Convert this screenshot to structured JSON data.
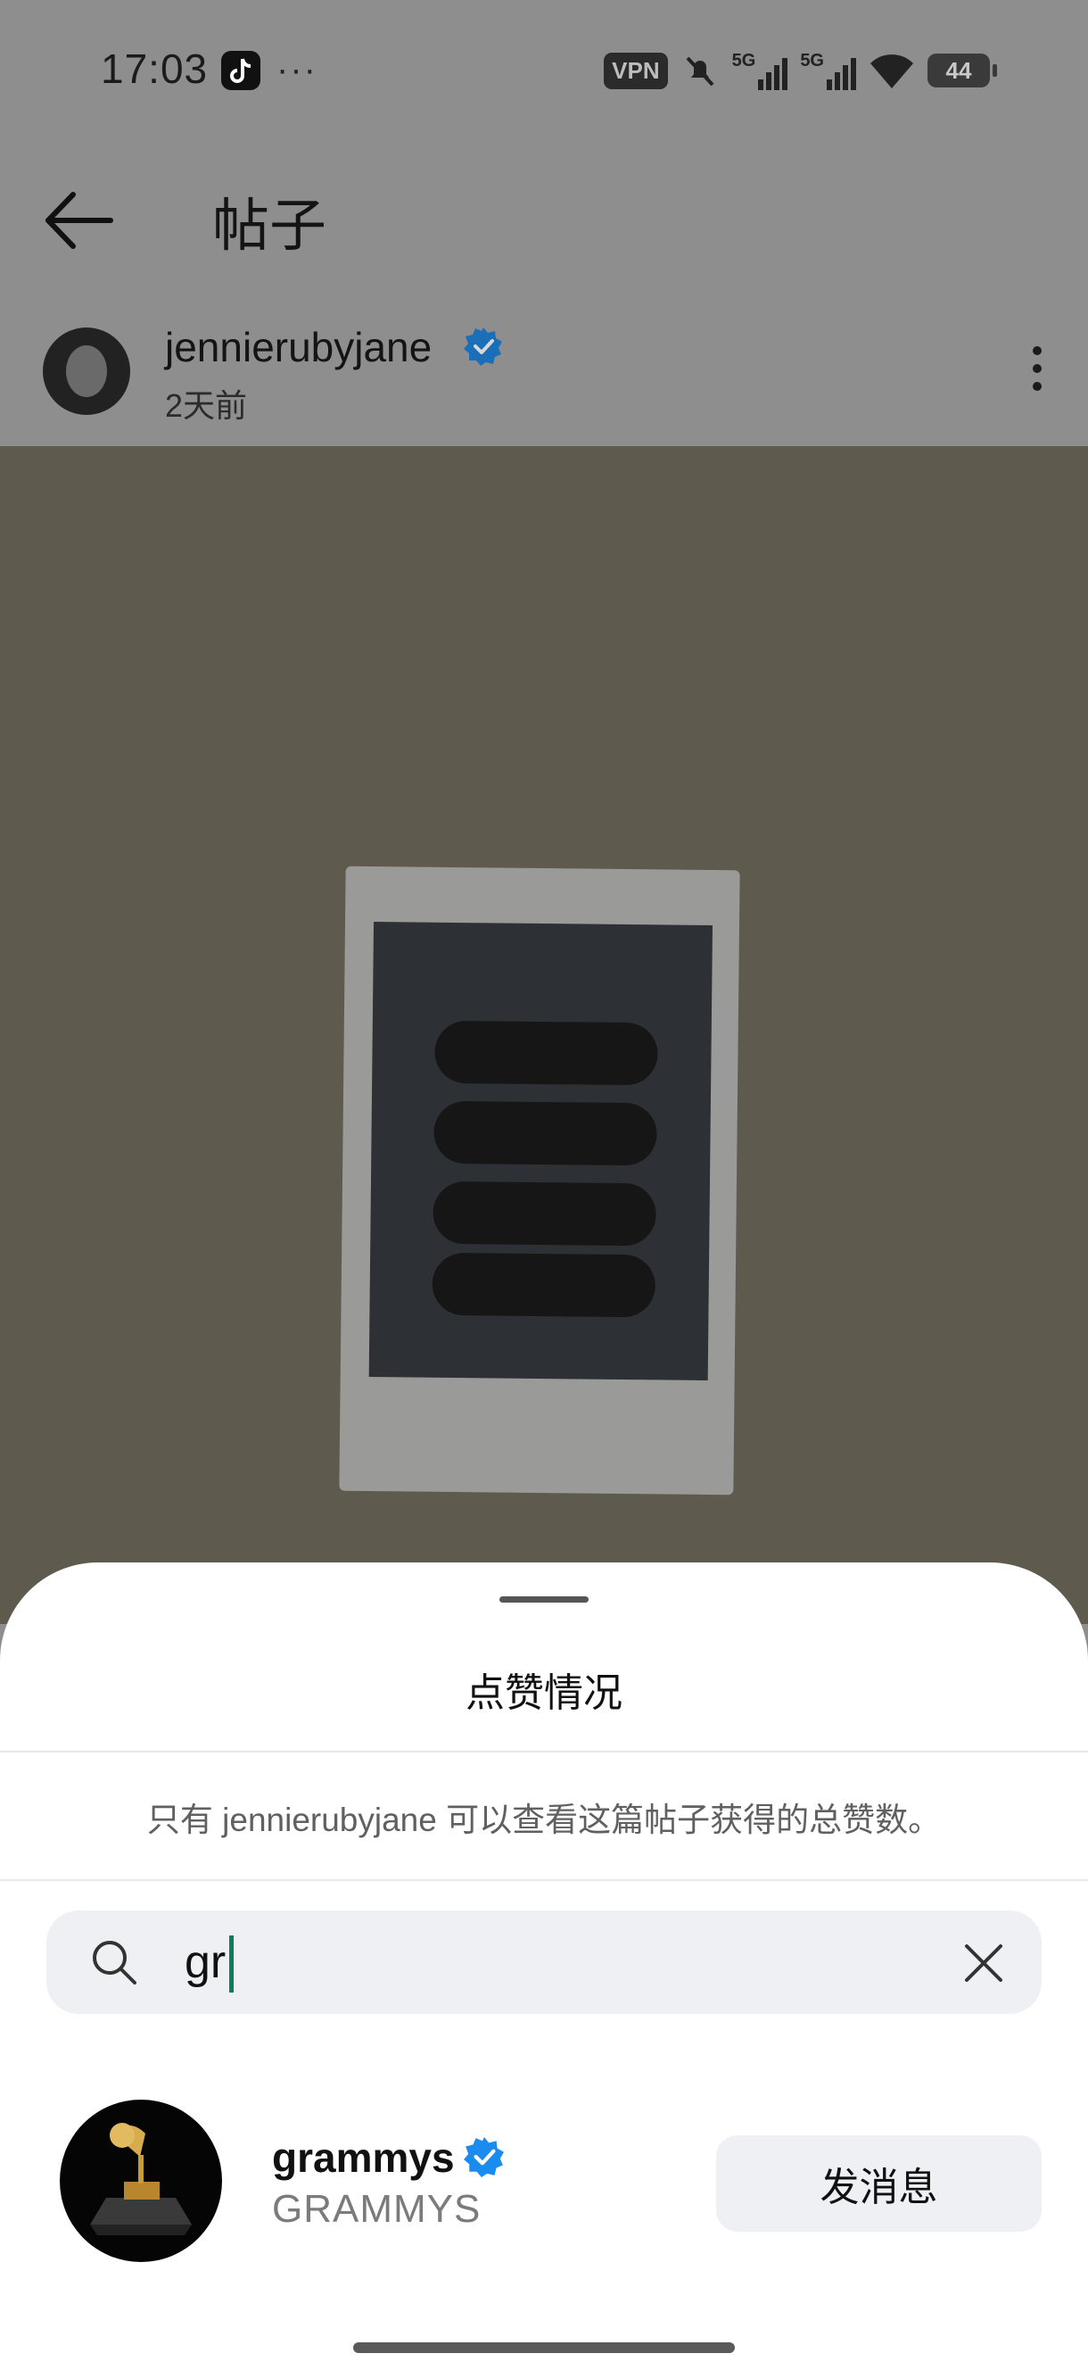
{
  "status_bar": {
    "time": "17:03",
    "overflow": "···",
    "vpn": "VPN",
    "signal_1": "5G",
    "signal_2": "5G",
    "battery": "44"
  },
  "header": {
    "title": "帖子",
    "back_icon": "arrow-left-icon"
  },
  "post": {
    "username": "jennierubyjane",
    "time_ago": "2天前",
    "verified": true
  },
  "likes_sheet": {
    "title": "点赞情况",
    "notice": "只有 jennierubyjane 可以查看这篇帖子获得的总赞数。",
    "search": {
      "value": "gr"
    },
    "results": [
      {
        "username": "grammys",
        "display_name": "GRAMMYS",
        "verified": true,
        "button_label": "发消息"
      }
    ]
  },
  "colors": {
    "verified_blue": "#1a8cf0",
    "caret_green": "#0a7d61",
    "sheet_bg": "#ffffff",
    "search_bg": "#eff0f3"
  }
}
